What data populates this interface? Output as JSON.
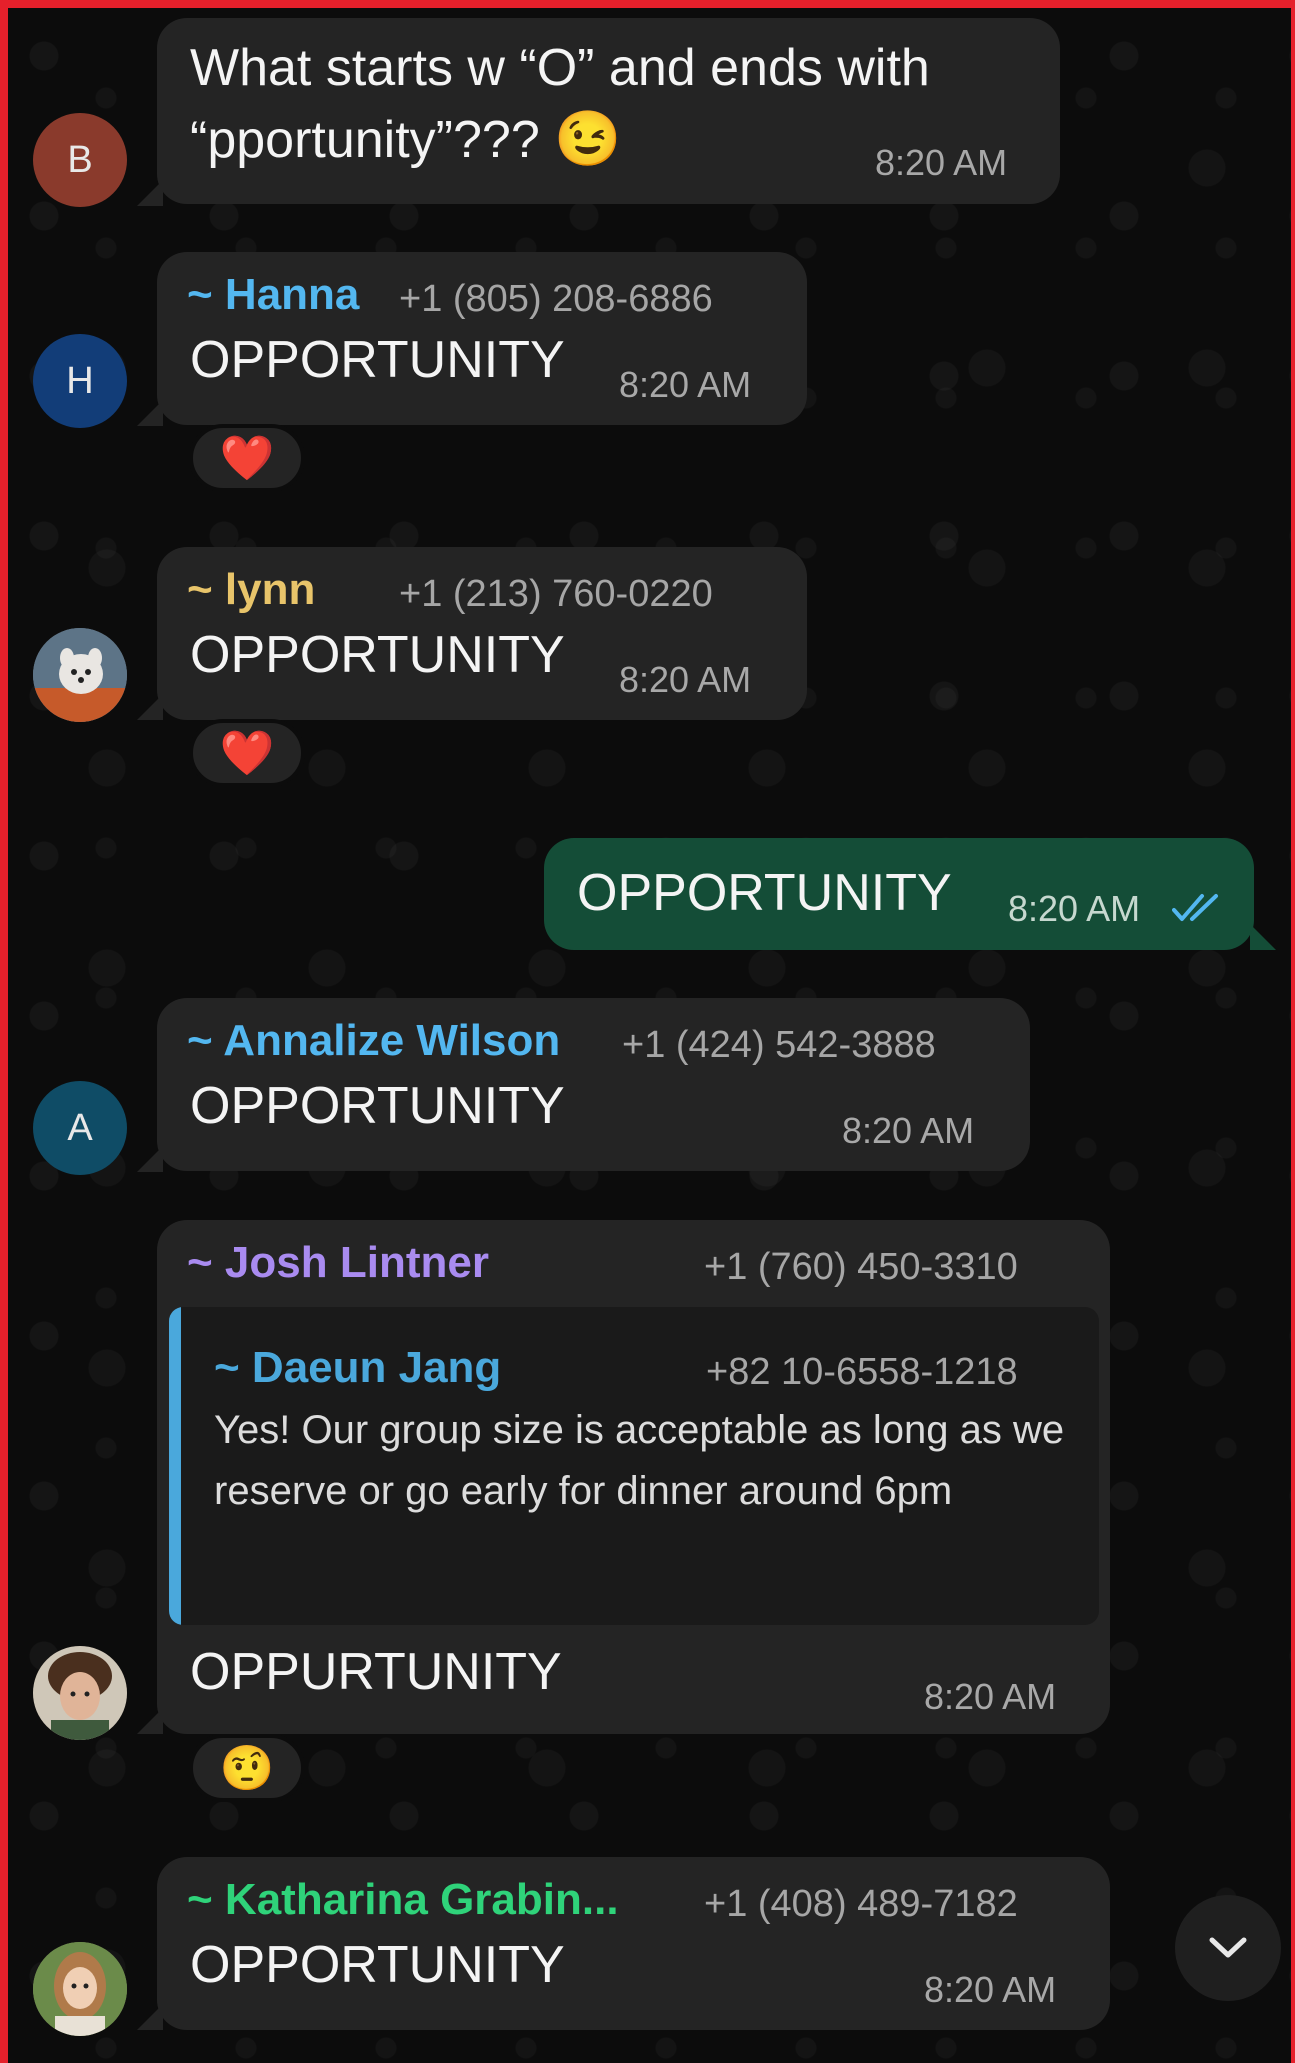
{
  "messages": [
    {
      "avatar_letter": "B",
      "avatar_color": "#8a3a2c",
      "text_line1": "What starts w “O” and ends with",
      "text_line2": "“pportunity”???",
      "emoji": "😉",
      "time": "8:20 AM"
    },
    {
      "avatar_letter": "H",
      "avatar_color": "#123d78",
      "sender": "~ Hanna",
      "sender_color": "#53b7f0",
      "phone": "+1 (805) 208-6886",
      "text": "OPPORTUNITY",
      "time": "8:20 AM",
      "reaction": "❤️"
    },
    {
      "sender": "~ lynn",
      "sender_color": "#e8c46a",
      "phone": "+1 (213) 760-0220",
      "text": "OPPORTUNITY",
      "time": "8:20 AM",
      "reaction": "❤️"
    },
    {
      "direction": "outgoing",
      "text": "OPPORTUNITY",
      "time": "8:20 AM",
      "status": "read-double-check"
    },
    {
      "avatar_letter": "A",
      "avatar_color": "#0f4c66",
      "sender": "~ Annalize Wilson",
      "sender_color": "#53b7f0",
      "phone": "+1 (424) 542-3888",
      "text": "OPPORTUNITY",
      "time": "8:20 AM"
    },
    {
      "sender": "~ Josh Lintner",
      "sender_color": "#a98bf0",
      "phone": "+1 (760) 450-3310",
      "quote": {
        "sender": "~ Daeun Jang",
        "sender_color": "#4aa8dc",
        "phone": "+82 10-6558-1218",
        "text": "Yes! Our group size is acceptable as long as we reserve or go early for dinner around 6pm"
      },
      "text": "OPPURTUNITY",
      "time": "8:20 AM",
      "reaction": "🤨"
    },
    {
      "sender": "~ Katharina Grabin...",
      "sender_color": "#2fd37a",
      "phone": "+1 (408) 489-7182",
      "text": "OPPORTUNITY",
      "time": "8:20 AM"
    }
  ],
  "scroll_button": {
    "icon": "chevron-down-icon"
  },
  "colors": {
    "incoming_bubble": "#242424",
    "outgoing_bubble": "#144d37",
    "read_check": "#53b7f0",
    "frame": "#e5202b"
  }
}
